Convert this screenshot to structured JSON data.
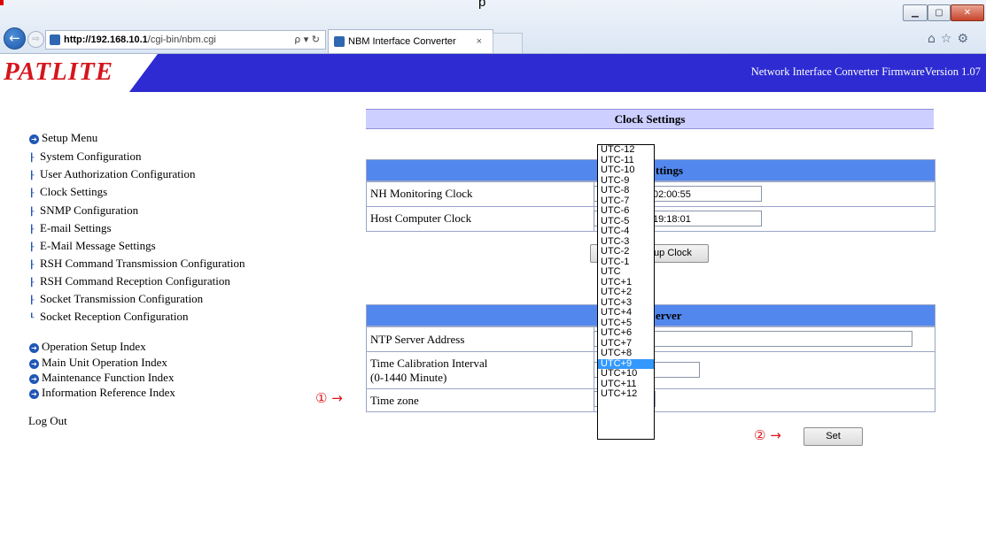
{
  "browser": {
    "partial_title": "p",
    "url_host": "http://192.168.10.1",
    "url_path": "/cgi-bin/nbm.cgi",
    "address_tools": "ρ ▾ ↻",
    "tab_title": "NBM Interface Converter",
    "tab_close": "×",
    "window_buttons": [
      "▁",
      "▢",
      "✕"
    ],
    "back_icon": "←",
    "forward_icon": "⇨",
    "right_icons": "⌂☆⚙"
  },
  "header": {
    "logo": "PATLITE",
    "info": "Network Interface Converter  FirmwareVersion 1.07"
  },
  "sidebar": {
    "setup_menu": "Setup Menu",
    "setup_items": [
      "System Configuration",
      "User Authorization Configuration",
      "Clock Settings",
      "SNMP Configuration",
      "E-mail Settings",
      "E-Mail Message Settings",
      "RSH Command Transmission Configuration",
      "RSH Command Reception Configuration",
      "Socket Transmission Configuration",
      "Socket Reception Configuration"
    ],
    "indexes": [
      "Operation Setup Index",
      "Main Unit Operation Index",
      "Maintenance Function Index",
      "Information Reference Index"
    ],
    "logout": "Log Out"
  },
  "main": {
    "title": "Clock Settings",
    "clock_table": {
      "header_visible": "ttings",
      "rows": [
        {
          "label": "NH Monitoring Clock",
          "value": "02:00:55"
        },
        {
          "label": "Host Computer Clock",
          "value": "19:18:01"
        }
      ],
      "button_visible": "tup Clock"
    },
    "ntp_table": {
      "header_visible": "erver",
      "rows": [
        {
          "label": "NTP Server Address",
          "value": ""
        },
        {
          "label": "Time Calibration Interval",
          "label2": "(0-1440 Minute)",
          "value": ""
        },
        {
          "label": "Time zone",
          "value": ""
        }
      ]
    },
    "set_button": "Set"
  },
  "annotations": {
    "one": "① →",
    "two": "② →"
  },
  "timezone_options": [
    "UTC-12",
    "UTC-11",
    "UTC-10",
    "UTC-9",
    "UTC-8",
    "UTC-7",
    "UTC-6",
    "UTC-5",
    "UTC-4",
    "UTC-3",
    "UTC-2",
    "UTC-1",
    "UTC",
    "UTC+1",
    "UTC+2",
    "UTC+3",
    "UTC+4",
    "UTC+5",
    "UTC+6",
    "UTC+7",
    "UTC+8",
    "UTC+9",
    "UTC+10",
    "UTC+11",
    "UTC+12"
  ],
  "timezone_selected": "UTC+9",
  "colors": {
    "header_bg": "#2d2bd1",
    "logo": "#d5161c",
    "table_header": "#5288ee",
    "title_bar": "#cccfff",
    "selected_option": "#3399ff",
    "annotation": "#d8141c"
  }
}
